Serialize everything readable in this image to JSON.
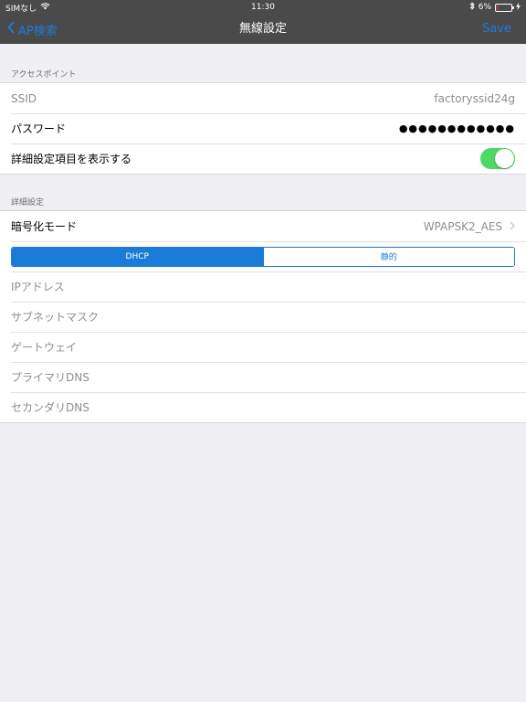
{
  "status_bar": {
    "carrier": "SIMなし",
    "time": "11:30",
    "battery_percent": "6%",
    "battery_level": 0.06
  },
  "nav": {
    "back_label": "AP検索",
    "title": "無線設定",
    "save_label": "Save"
  },
  "access_point": {
    "header": "アクセスポイント",
    "ssid_label": "SSID",
    "ssid_value": "factoryssid24g",
    "password_label": "パスワード",
    "password_value": "●●●●●●●●●●●●",
    "show_advanced_label": "詳細設定項目を表示する",
    "show_advanced_on": true
  },
  "advanced": {
    "header": "詳細設定",
    "encryption_label": "暗号化モード",
    "encryption_value": "WPAPSK2_AES",
    "segments": [
      "DHCP",
      "静的"
    ],
    "selected_segment": "DHCP",
    "fields": [
      "IPアドレス",
      "サブネットマスク",
      "ゲートウェイ",
      "プライマリDNS",
      "セカンダリDNS"
    ]
  },
  "colors": {
    "accent": "#1a7cd6",
    "toggle_on": "#4cd964",
    "battery_low": "#ff3b30",
    "bar_bg": "#4a4a4a",
    "page_bg": "#efeff4"
  }
}
